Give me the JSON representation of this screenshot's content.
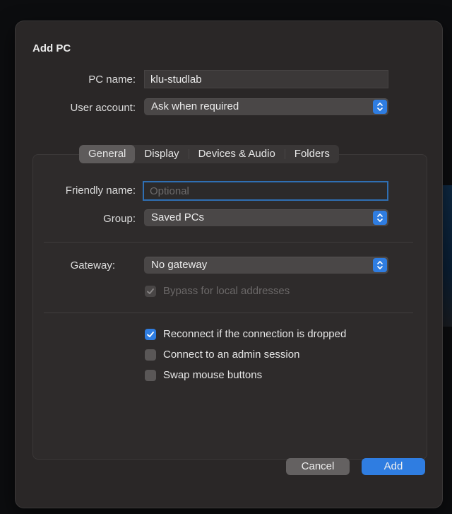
{
  "dialog": {
    "title": "Add PC",
    "pc_name_label": "PC name:",
    "pc_name_value": "klu-studlab",
    "user_account_label": "User account:",
    "user_account_value": "Ask when required"
  },
  "tabs": [
    {
      "label": "General",
      "selected": true
    },
    {
      "label": "Display",
      "selected": false
    },
    {
      "label": "Devices & Audio",
      "selected": false
    },
    {
      "label": "Folders",
      "selected": false
    }
  ],
  "general": {
    "friendly_name_label": "Friendly name:",
    "friendly_name_placeholder": "Optional",
    "group_label": "Group:",
    "group_value": "Saved PCs",
    "gateway_label": "Gateway:",
    "gateway_value": "No gateway",
    "bypass_label": "Bypass for local addresses",
    "bypass_checked": true,
    "bypass_enabled": false,
    "options": [
      {
        "label": "Reconnect if the connection is dropped",
        "checked": true
      },
      {
        "label": "Connect to an admin session",
        "checked": false
      },
      {
        "label": "Swap mouse buttons",
        "checked": false
      }
    ]
  },
  "buttons": {
    "cancel": "Cancel",
    "add": "Add"
  },
  "colors": {
    "accent": "#2f7de1",
    "dialog_bg": "#2a2727",
    "focus_ring": "#2f6fb3"
  }
}
